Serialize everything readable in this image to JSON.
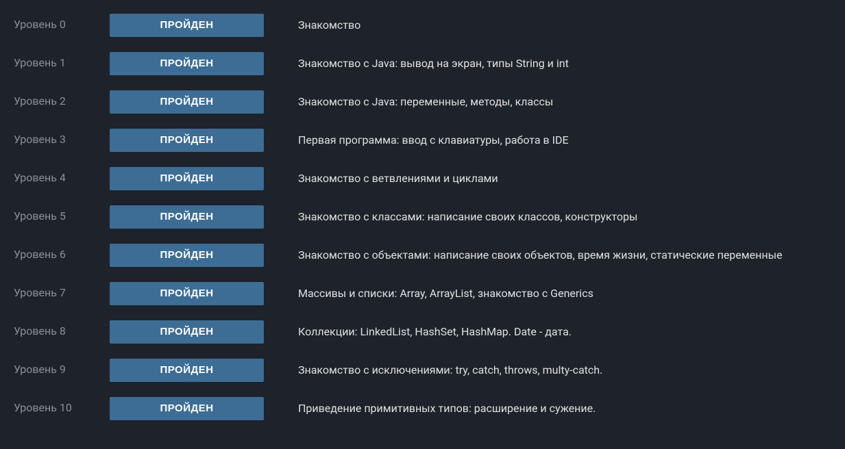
{
  "status_label": "ПРОЙДЕН",
  "levels": [
    {
      "label": "Уровень 0",
      "description": "Знакомство"
    },
    {
      "label": "Уровень 1",
      "description": "Знакомство с Java: вывод на экран, типы String и int"
    },
    {
      "label": "Уровень 2",
      "description": "Знакомство с Java: переменные, методы, классы"
    },
    {
      "label": "Уровень 3",
      "description": "Первая программа: ввод с клавиатуры, работа в IDE"
    },
    {
      "label": "Уровень 4",
      "description": "Знакомство с ветвлениями и циклами"
    },
    {
      "label": "Уровень 5",
      "description": "Знакомство с классами: написание своих классов, конструкторы"
    },
    {
      "label": "Уровень 6",
      "description": "Знакомство с объектами: написание своих объектов, время жизни, статические переменные"
    },
    {
      "label": "Уровень 7",
      "description": "Массивы и списки: Array, ArrayList, знакомство с Generics"
    },
    {
      "label": "Уровень 8",
      "description": "Коллекции: LinkedList, HashSet, HashMap. Date - дата."
    },
    {
      "label": "Уровень 9",
      "description": "Знакомство с исключениями: try, catch, throws, multy-catch."
    },
    {
      "label": "Уровень 10",
      "description": "Приведение примитивных типов: расширение и сужение."
    }
  ]
}
